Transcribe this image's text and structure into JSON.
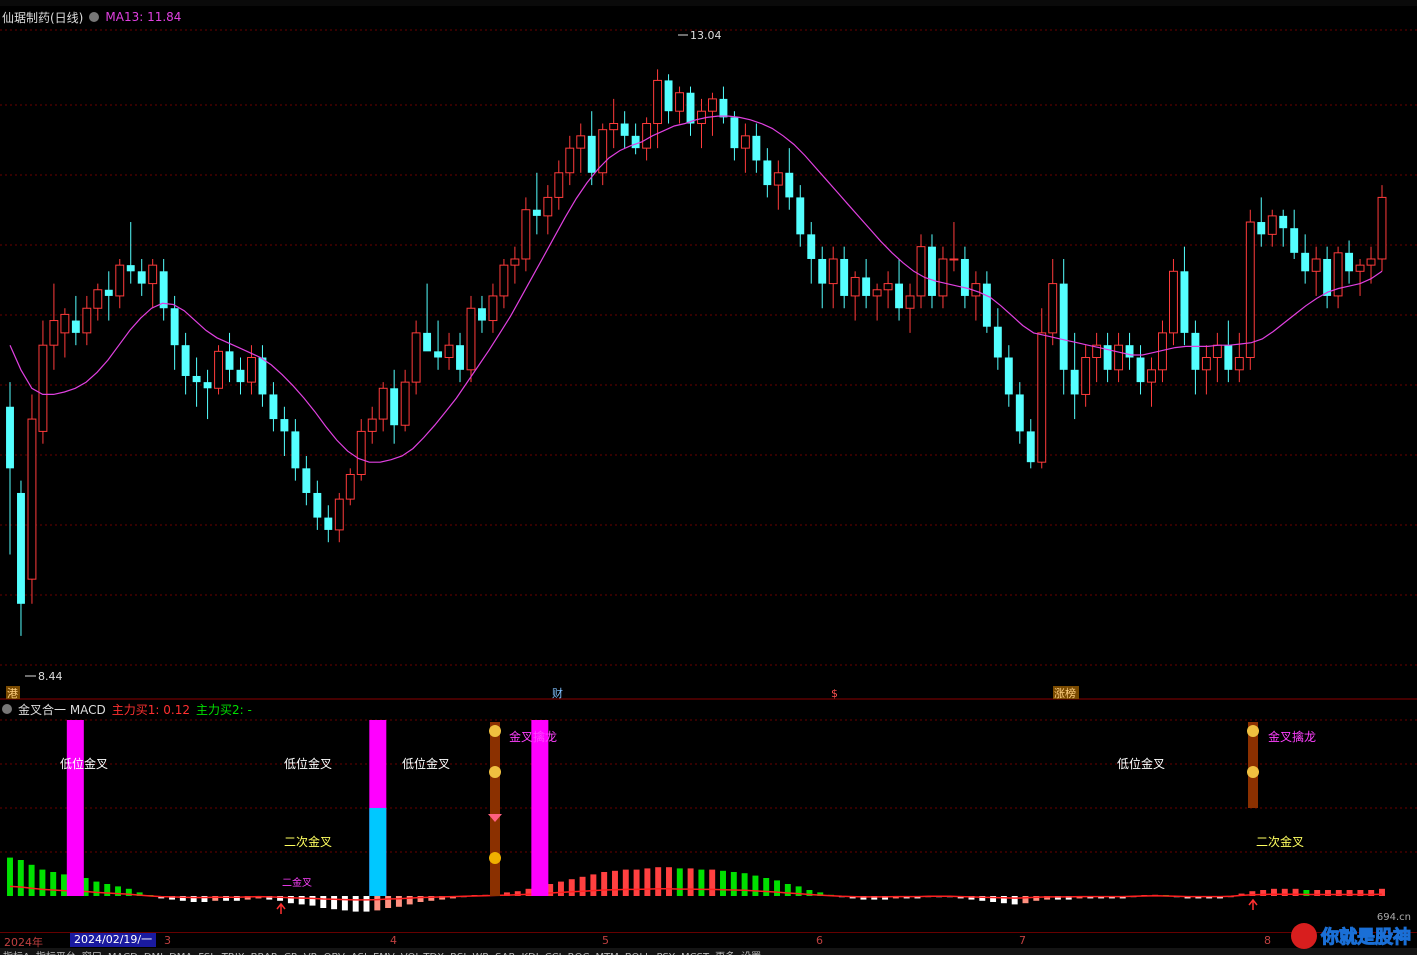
{
  "header": {
    "stock_title": "仙琚制药(日线)",
    "ma_label": "MA13: 11.84"
  },
  "price_chart": {
    "high_label": "13.04",
    "low_label": "8.44",
    "event_markers": [
      "港",
      "财",
      "$",
      "涨榜"
    ]
  },
  "indicator": {
    "name": "金叉合一 MACD",
    "value1": "主力买1: 0.12",
    "value2": "主力买2: -",
    "signals": [
      "低位金叉",
      "低位金叉",
      "低位金叉",
      "低位金叉",
      "金叉擒龙",
      "金叉擒龙",
      "二次金叉",
      "二次金叉",
      "二金叉"
    ]
  },
  "date_axis": {
    "year": "2024年",
    "cursor_date": "2024/02/19/一",
    "months": [
      "3",
      "4",
      "5",
      "6",
      "7",
      "8"
    ]
  },
  "tabs": [
    "指标A",
    "指标平台",
    "窗口",
    "MACD",
    "DMI",
    "DMA",
    "FSL",
    "TRIX",
    "BRAR",
    "CR",
    "VR",
    "OBV",
    "ASI",
    "EMV",
    "VOL-TDX",
    "RSI",
    "WR",
    "SAR",
    "KDJ",
    "CCI",
    "ROC",
    "MTM",
    "BOLL",
    "PSY",
    "MCST",
    "更多",
    "设置"
  ],
  "watermark": {
    "text": "你就是股神",
    "site": "694.cn"
  },
  "colors": {
    "up": "#ff3b3b",
    "down": "#54ffff",
    "ma": "#e040e0",
    "grid": "#6a0000",
    "magenta_bar": "#ff00ff",
    "cyan_bar": "#00c8ff"
  },
  "chart_data": {
    "type": "candlestick",
    "ylim": [
      8.0,
      13.4
    ],
    "ohlc": [
      [
        10.3,
        10.5,
        9.1,
        9.8
      ],
      [
        9.6,
        9.7,
        8.44,
        8.7
      ],
      [
        8.9,
        10.4,
        8.7,
        10.2
      ],
      [
        10.1,
        11.0,
        10.0,
        10.8
      ],
      [
        10.8,
        11.3,
        10.6,
        11.0
      ],
      [
        10.9,
        11.1,
        10.7,
        11.05
      ],
      [
        11.0,
        11.2,
        10.8,
        10.9
      ],
      [
        10.9,
        11.2,
        10.8,
        11.1
      ],
      [
        11.1,
        11.3,
        11.0,
        11.25
      ],
      [
        11.25,
        11.4,
        11.0,
        11.2
      ],
      [
        11.2,
        11.5,
        11.1,
        11.45
      ],
      [
        11.45,
        11.8,
        11.3,
        11.4
      ],
      [
        11.4,
        11.5,
        11.2,
        11.3
      ],
      [
        11.3,
        11.5,
        11.1,
        11.45
      ],
      [
        11.4,
        11.5,
        11.0,
        11.1
      ],
      [
        11.1,
        11.2,
        10.6,
        10.8
      ],
      [
        10.8,
        10.9,
        10.4,
        10.55
      ],
      [
        10.55,
        10.7,
        10.3,
        10.5
      ],
      [
        10.5,
        10.6,
        10.2,
        10.45
      ],
      [
        10.45,
        10.8,
        10.4,
        10.75
      ],
      [
        10.75,
        10.9,
        10.5,
        10.6
      ],
      [
        10.6,
        10.7,
        10.4,
        10.5
      ],
      [
        10.5,
        10.8,
        10.4,
        10.7
      ],
      [
        10.7,
        10.8,
        10.3,
        10.4
      ],
      [
        10.4,
        10.5,
        10.1,
        10.2
      ],
      [
        10.2,
        10.3,
        9.9,
        10.1
      ],
      [
        10.1,
        10.2,
        9.7,
        9.8
      ],
      [
        9.8,
        9.9,
        9.5,
        9.6
      ],
      [
        9.6,
        9.7,
        9.3,
        9.4
      ],
      [
        9.4,
        9.5,
        9.2,
        9.3
      ],
      [
        9.3,
        9.6,
        9.2,
        9.55
      ],
      [
        9.55,
        9.8,
        9.5,
        9.75
      ],
      [
        9.75,
        10.2,
        9.7,
        10.1
      ],
      [
        10.1,
        10.3,
        10.0,
        10.2
      ],
      [
        10.2,
        10.5,
        10.1,
        10.45
      ],
      [
        10.45,
        10.6,
        10.0,
        10.15
      ],
      [
        10.15,
        10.6,
        10.1,
        10.5
      ],
      [
        10.5,
        11.0,
        10.4,
        10.9
      ],
      [
        10.9,
        11.3,
        10.8,
        10.75
      ],
      [
        10.75,
        11.0,
        10.6,
        10.7
      ],
      [
        10.7,
        10.9,
        10.6,
        10.8
      ],
      [
        10.8,
        10.9,
        10.5,
        10.6
      ],
      [
        10.6,
        11.2,
        10.5,
        11.1
      ],
      [
        11.1,
        11.2,
        10.9,
        11.0
      ],
      [
        11.0,
        11.3,
        10.9,
        11.2
      ],
      [
        11.2,
        11.5,
        11.1,
        11.45
      ],
      [
        11.45,
        11.6,
        11.3,
        11.5
      ],
      [
        11.5,
        12.0,
        11.4,
        11.9
      ],
      [
        11.9,
        12.2,
        11.7,
        11.85
      ],
      [
        11.85,
        12.1,
        11.7,
        12.0
      ],
      [
        12.0,
        12.3,
        11.9,
        12.2
      ],
      [
        12.2,
        12.5,
        12.1,
        12.4
      ],
      [
        12.4,
        12.6,
        12.2,
        12.5
      ],
      [
        12.5,
        12.7,
        12.1,
        12.2
      ],
      [
        12.2,
        12.6,
        12.1,
        12.55
      ],
      [
        12.55,
        12.8,
        12.4,
        12.6
      ],
      [
        12.6,
        12.7,
        12.4,
        12.5
      ],
      [
        12.5,
        12.6,
        12.35,
        12.4
      ],
      [
        12.4,
        12.65,
        12.3,
        12.6
      ],
      [
        12.6,
        13.04,
        12.4,
        12.95
      ],
      [
        12.95,
        13.0,
        12.6,
        12.7
      ],
      [
        12.7,
        12.9,
        12.6,
        12.85
      ],
      [
        12.85,
        12.9,
        12.5,
        12.6
      ],
      [
        12.6,
        12.8,
        12.4,
        12.7
      ],
      [
        12.7,
        12.85,
        12.5,
        12.8
      ],
      [
        12.8,
        12.9,
        12.6,
        12.65
      ],
      [
        12.65,
        12.7,
        12.3,
        12.4
      ],
      [
        12.4,
        12.6,
        12.2,
        12.5
      ],
      [
        12.5,
        12.6,
        12.2,
        12.3
      ],
      [
        12.3,
        12.4,
        12.0,
        12.1
      ],
      [
        12.1,
        12.3,
        11.9,
        12.2
      ],
      [
        12.2,
        12.4,
        11.9,
        12.0
      ],
      [
        12.0,
        12.1,
        11.6,
        11.7
      ],
      [
        11.7,
        11.8,
        11.3,
        11.5
      ],
      [
        11.5,
        11.6,
        11.1,
        11.3
      ],
      [
        11.3,
        11.6,
        11.1,
        11.5
      ],
      [
        11.5,
        11.6,
        11.1,
        11.2
      ],
      [
        11.2,
        11.4,
        11.0,
        11.35
      ],
      [
        11.35,
        11.5,
        11.1,
        11.2
      ],
      [
        11.2,
        11.3,
        11.0,
        11.25
      ],
      [
        11.25,
        11.4,
        11.1,
        11.3
      ],
      [
        11.3,
        11.5,
        11.0,
        11.1
      ],
      [
        11.1,
        11.3,
        10.9,
        11.2
      ],
      [
        11.2,
        11.7,
        11.1,
        11.6
      ],
      [
        11.6,
        11.7,
        11.1,
        11.2
      ],
      [
        11.2,
        11.6,
        11.1,
        11.5
      ],
      [
        11.5,
        11.8,
        11.4,
        11.5
      ],
      [
        11.5,
        11.6,
        11.1,
        11.2
      ],
      [
        11.2,
        11.4,
        11.0,
        11.3
      ],
      [
        11.3,
        11.4,
        10.9,
        10.95
      ],
      [
        10.95,
        11.1,
        10.6,
        10.7
      ],
      [
        10.7,
        10.8,
        10.3,
        10.4
      ],
      [
        10.4,
        10.5,
        10.0,
        10.1
      ],
      [
        10.1,
        10.2,
        9.8,
        9.85
      ],
      [
        9.85,
        11.1,
        9.8,
        10.9
      ],
      [
        10.9,
        11.5,
        10.8,
        11.3
      ],
      [
        11.3,
        11.5,
        10.4,
        10.6
      ],
      [
        10.6,
        10.9,
        10.2,
        10.4
      ],
      [
        10.4,
        10.8,
        10.3,
        10.7
      ],
      [
        10.7,
        10.9,
        10.5,
        10.8
      ],
      [
        10.8,
        10.9,
        10.5,
        10.6
      ],
      [
        10.6,
        10.9,
        10.5,
        10.8
      ],
      [
        10.8,
        10.9,
        10.6,
        10.7
      ],
      [
        10.7,
        10.8,
        10.4,
        10.5
      ],
      [
        10.5,
        10.7,
        10.3,
        10.6
      ],
      [
        10.6,
        11.0,
        10.5,
        10.9
      ],
      [
        10.9,
        11.5,
        10.8,
        11.4
      ],
      [
        11.4,
        11.6,
        10.8,
        10.9
      ],
      [
        10.9,
        11.0,
        10.4,
        10.6
      ],
      [
        10.6,
        10.8,
        10.4,
        10.7
      ],
      [
        10.7,
        10.9,
        10.5,
        10.8
      ],
      [
        10.8,
        11.0,
        10.5,
        10.6
      ],
      [
        10.6,
        10.9,
        10.5,
        10.7
      ],
      [
        10.7,
        11.9,
        10.6,
        11.8
      ],
      [
        11.8,
        12.0,
        11.6,
        11.7
      ],
      [
        11.7,
        11.9,
        11.6,
        11.85
      ],
      [
        11.85,
        11.9,
        11.6,
        11.75
      ],
      [
        11.75,
        11.9,
        11.5,
        11.55
      ],
      [
        11.55,
        11.7,
        11.3,
        11.4
      ],
      [
        11.4,
        11.6,
        11.2,
        11.5
      ],
      [
        11.5,
        11.6,
        11.1,
        11.2
      ],
      [
        11.2,
        11.6,
        11.1,
        11.55
      ],
      [
        11.55,
        11.65,
        11.3,
        11.4
      ],
      [
        11.4,
        11.5,
        11.2,
        11.45
      ],
      [
        11.45,
        11.6,
        11.3,
        11.5
      ],
      [
        11.5,
        12.1,
        11.4,
        12.0
      ]
    ],
    "ma13": [
      10.8,
      10.6,
      10.45,
      10.4,
      10.4,
      10.42,
      10.45,
      10.5,
      10.58,
      10.68,
      10.8,
      10.92,
      11.02,
      11.1,
      11.14,
      11.13,
      11.08,
      11.0,
      10.92,
      10.86,
      10.82,
      10.78,
      10.74,
      10.7,
      10.64,
      10.56,
      10.47,
      10.37,
      10.26,
      10.14,
      10.03,
      9.94,
      9.88,
      9.85,
      9.85,
      9.87,
      9.9,
      9.96,
      10.05,
      10.15,
      10.26,
      10.37,
      10.5,
      10.63,
      10.76,
      10.9,
      11.04,
      11.2,
      11.36,
      11.52,
      11.68,
      11.84,
      11.99,
      12.12,
      12.23,
      12.32,
      12.38,
      12.42,
      12.45,
      12.5,
      12.54,
      12.58,
      12.6,
      12.63,
      12.65,
      12.66,
      12.66,
      12.65,
      12.63,
      12.6,
      12.56,
      12.5,
      12.43,
      12.34,
      12.24,
      12.14,
      12.04,
      11.94,
      11.84,
      11.74,
      11.64,
      11.55,
      11.47,
      11.4,
      11.35,
      11.32,
      11.3,
      11.28,
      11.26,
      11.23,
      11.19,
      11.12,
      11.04,
      10.96,
      10.9,
      10.88,
      10.86,
      10.84,
      10.82,
      10.8,
      10.78,
      10.76,
      10.74,
      10.72,
      10.72,
      10.74,
      10.76,
      10.78,
      10.79,
      10.79,
      10.79,
      10.8,
      10.8,
      10.81,
      10.82,
      10.85,
      10.91,
      10.98,
      11.05,
      11.12,
      11.18,
      11.23,
      11.26,
      11.28,
      11.3,
      11.34,
      11.4
    ],
    "macd_hist": [
      0.32,
      0.3,
      0.26,
      0.22,
      0.2,
      0.18,
      0.17,
      0.15,
      0.12,
      0.1,
      0.08,
      0.06,
      0.03,
      0.0,
      -0.02,
      -0.03,
      -0.04,
      -0.05,
      -0.05,
      -0.04,
      -0.04,
      -0.04,
      -0.03,
      -0.02,
      -0.03,
      -0.04,
      -0.06,
      -0.07,
      -0.08,
      -0.1,
      -0.11,
      -0.12,
      -0.13,
      -0.13,
      -0.12,
      -0.1,
      -0.09,
      -0.07,
      -0.05,
      -0.04,
      -0.03,
      -0.02,
      -0.01,
      0.0,
      0.01,
      0.02,
      0.03,
      0.04,
      0.06,
      0.08,
      0.1,
      0.12,
      0.14,
      0.16,
      0.18,
      0.2,
      0.21,
      0.22,
      0.22,
      0.23,
      0.24,
      0.24,
      0.23,
      0.23,
      0.22,
      0.22,
      0.21,
      0.2,
      0.19,
      0.17,
      0.15,
      0.13,
      0.1,
      0.08,
      0.05,
      0.03,
      0.01,
      -0.01,
      -0.02,
      -0.03,
      -0.03,
      -0.03,
      -0.02,
      -0.02,
      -0.02,
      -0.01,
      -0.01,
      -0.01,
      -0.02,
      -0.03,
      -0.04,
      -0.05,
      -0.06,
      -0.07,
      -0.06,
      -0.04,
      -0.03,
      -0.03,
      -0.03,
      -0.02,
      -0.02,
      -0.02,
      -0.02,
      -0.02,
      -0.01,
      0.0,
      0.01,
      0.0,
      -0.01,
      -0.02,
      -0.02,
      -0.02,
      -0.02,
      -0.01,
      0.02,
      0.04,
      0.05,
      0.06,
      0.06,
      0.06,
      0.05,
      0.05,
      0.05,
      0.05,
      0.05,
      0.05,
      0.05,
      0.06
    ],
    "signal_bars": [
      {
        "index": 6,
        "color": "magenta",
        "top": 1.0,
        "label": "低位金叉"
      },
      {
        "index": 34,
        "color": "magenta",
        "top": 1.0,
        "label": "低位金叉"
      },
      {
        "index": 34,
        "color": "cyan",
        "top": 0.5,
        "label": "二次金叉"
      },
      {
        "index": 49,
        "color": "magenta",
        "top": 1.0,
        "label": "低位金叉"
      },
      {
        "index": 138,
        "color": "magenta",
        "top": 1.0,
        "label": "低位金叉"
      },
      {
        "index": 156,
        "color": "cyan",
        "top": 0.5,
        "label": "二次金叉"
      }
    ]
  }
}
